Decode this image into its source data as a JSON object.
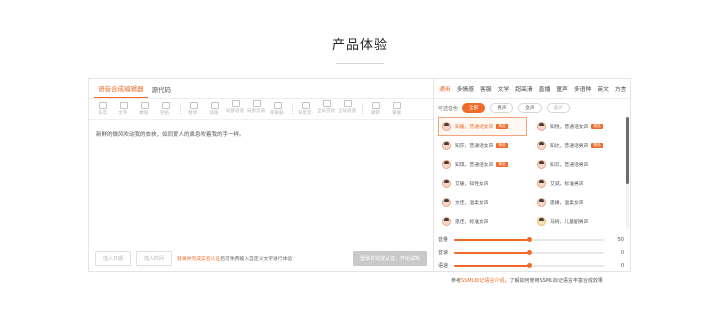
{
  "section": {
    "title": "产品体验"
  },
  "editor": {
    "tabs": [
      {
        "label": "语音合成编辑器",
        "active": true
      },
      {
        "label": "源代码",
        "active": false
      }
    ],
    "toolbar": [
      {
        "icon": "tts-icon",
        "label": "多音"
      },
      {
        "icon": "text-icon",
        "label": "文字·"
      },
      {
        "icon": "digit-icon",
        "label": "数值·"
      },
      {
        "icon": "alias-icon",
        "label": "别名·"
      },
      {
        "icon": "pause-icon",
        "label": "暂停·"
      },
      {
        "icon": "voice-icon",
        "label": "语速·"
      },
      {
        "icon": "speed-icon",
        "label": "局部语速·"
      },
      {
        "icon": "pitch-icon",
        "label": "局部音调·"
      },
      {
        "icon": "effect-icon",
        "label": "效果器·"
      },
      {
        "icon": "bgm-icon",
        "label": "背景音·"
      },
      {
        "icon": "volume-icon",
        "label": "全局音效·"
      },
      {
        "icon": "global-effect-icon",
        "label": "全局语速·"
      },
      {
        "icon": "undo-icon",
        "label": "撤销"
      },
      {
        "icon": "redo-icon",
        "label": "重做"
      }
    ],
    "text": "新鲜的微风吹动我的衣袂，如同爱人的鼻息吹着我的手一样。",
    "footer": {
      "btn_reset": "插入日期",
      "btn_fill": "插入时间",
      "note_prefix": "",
      "note_link": "登录并完成实名认证",
      "note_suffix": "后可免费输入自定义文字进行体验",
      "btn_play": "登录并完成认证，开始试听"
    }
  },
  "panel": {
    "tabs": [
      {
        "label": "通用",
        "active": true
      },
      {
        "label": "多情感",
        "active": false
      },
      {
        "label": "客服",
        "active": false
      },
      {
        "label": "文学",
        "active": false
      },
      {
        "label": "超高清",
        "active": false
      },
      {
        "label": "直播",
        "active": false
      },
      {
        "label": "童声",
        "active": false
      },
      {
        "label": "多语种",
        "active": false
      },
      {
        "label": "英文",
        "active": false
      },
      {
        "label": "方言",
        "active": false
      }
    ],
    "filter": {
      "label": "可选音色",
      "options": [
        {
          "label": "全部",
          "state": "on"
        },
        {
          "label": "男声",
          "state": "normal"
        },
        {
          "label": "女声",
          "state": "normal"
        },
        {
          "label": "童声",
          "state": "off"
        }
      ]
    },
    "voices": [
      {
        "name": "知媛，普通话女声",
        "badge": "精品",
        "selected": true,
        "avatar": "female"
      },
      {
        "name": "知悦，普通话女声",
        "badge": "精品",
        "selected": false,
        "avatar": "female"
      },
      {
        "name": "知莎，普通话女声",
        "badge": "精品",
        "selected": false,
        "avatar": "female"
      },
      {
        "name": "知达，普通话男声",
        "badge": "精品",
        "selected": false,
        "avatar": "male"
      },
      {
        "name": "知琪，普通话女声",
        "badge": "精品",
        "selected": false,
        "avatar": "female"
      },
      {
        "name": "知云，普通话男声",
        "badge": "",
        "selected": false,
        "avatar": "male"
      },
      {
        "name": "艾媛，知性女声",
        "badge": "",
        "selected": false,
        "avatar": "female"
      },
      {
        "name": "艾诚，标准男声",
        "badge": "",
        "selected": false,
        "avatar": "male"
      },
      {
        "name": "文佳，温柔女声",
        "badge": "",
        "selected": false,
        "avatar": "female"
      },
      {
        "name": "思婧，温柔女声",
        "badge": "",
        "selected": false,
        "avatar": "female"
      },
      {
        "name": "思佳，标准女声",
        "badge": "",
        "selected": false,
        "avatar": "female"
      },
      {
        "name": "马树，儿童剧男声",
        "badge": "",
        "selected": false,
        "avatar": "kid"
      }
    ],
    "sliders": [
      {
        "label": "音量",
        "value": 50,
        "fill_percent": 50
      },
      {
        "label": "音速",
        "value": 0,
        "fill_percent": 50
      },
      {
        "label": "语速",
        "value": 0,
        "fill_percent": 50
      }
    ],
    "scroll_thumb_fraction": 0.6
  },
  "bottom_note": {
    "prefix": "参考",
    "link": "SSML标记语言介绍",
    "suffix": "，了解如何使用SSML标记语言丰富合成效果"
  },
  "colors": {
    "accent": "#f06b2a",
    "border": "#e4e4e4"
  }
}
